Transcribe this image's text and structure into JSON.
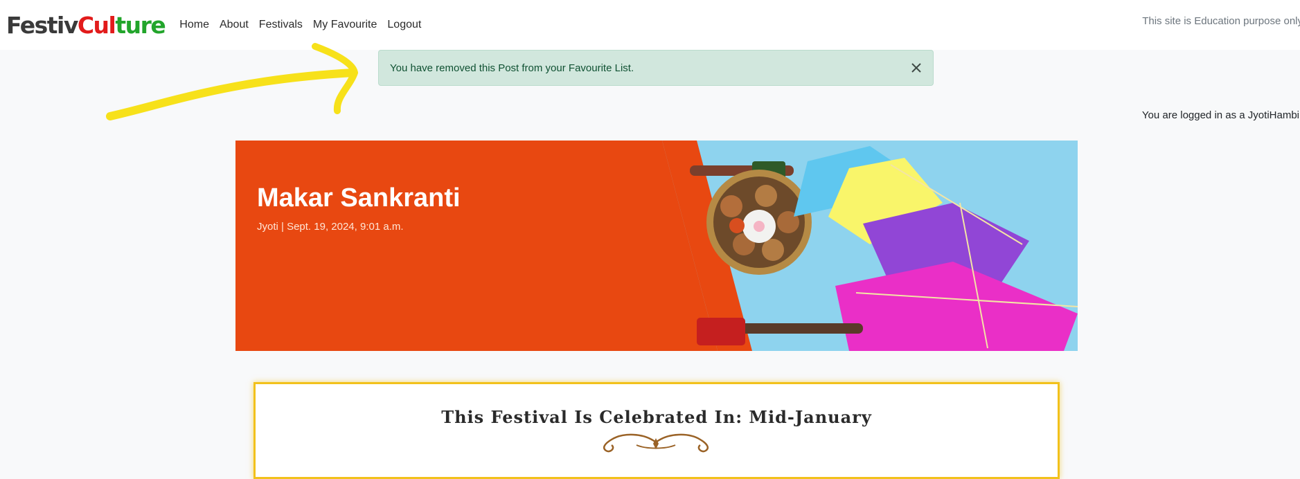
{
  "brand": {
    "part1": "Festiv",
    "part2": "Cul",
    "part3": "ture"
  },
  "nav": [
    {
      "label": "Home"
    },
    {
      "label": "About"
    },
    {
      "label": "Festivals"
    },
    {
      "label": "My Favourite"
    },
    {
      "label": "Logout"
    }
  ],
  "site_note": "This site is Education purpose only",
  "alert": {
    "message": "You have removed this Post from your Favourite List."
  },
  "user": {
    "logged_in_text": "You are logged in as a JyotiHambir"
  },
  "post": {
    "title": "Makar Sankranti",
    "meta": "Jyoti | Sept. 19, 2024, 9:01 a.m.",
    "celebrated": "This Festival Is Celebrated In: Mid-January"
  },
  "colors": {
    "hero_bg": "#e84811",
    "alert_bg": "#d1e7dd",
    "highlight_box": "#f2c11b",
    "annotation_arrow": "#f7e11a"
  }
}
